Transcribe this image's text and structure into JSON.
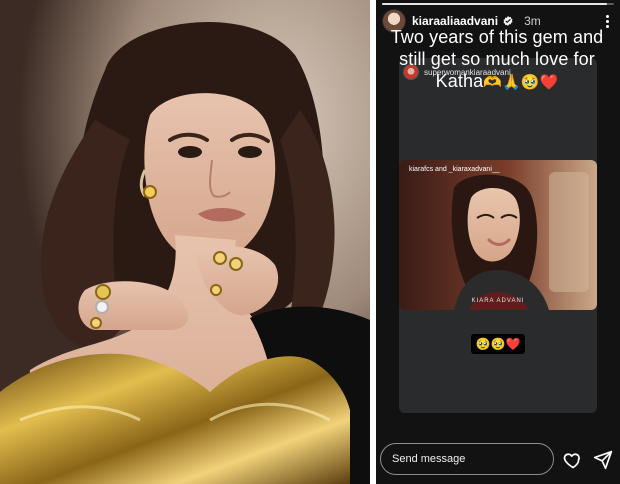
{
  "story": {
    "username": "kiaraaliaadvani",
    "time": "3m",
    "progress_fraction": 0.97,
    "repost_username": "superwomankiaraadvani",
    "caption_text": "Two years of this gem and still get so much love for Katha",
    "caption_emojis": "🫶🙏🥹❤️",
    "clip_label": "kiarafcs and _kiaraxadvani__",
    "clip_caption": "KIARA ADVANI",
    "reaction_emojis": "🥹🥹❤️",
    "send_placeholder": "Send message"
  },
  "icons": {
    "verified": "verified-badge-icon",
    "more": "more-options-icon",
    "like": "heart-icon",
    "share": "paper-plane-icon"
  },
  "colors": {
    "story_bg": "#121212",
    "card_bg": "#2a2b2d",
    "verified_blue": "#1d9bf0",
    "heart_red": "#e0245e"
  }
}
